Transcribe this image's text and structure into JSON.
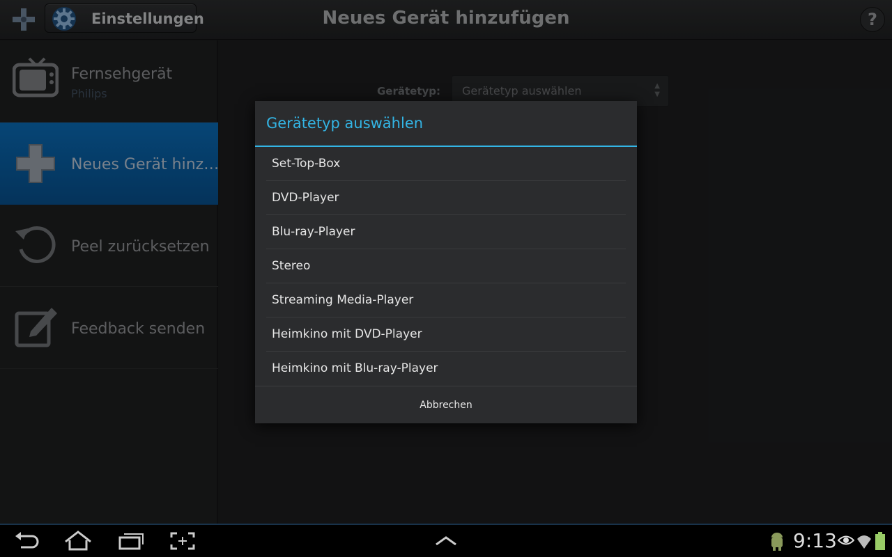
{
  "action_bar": {
    "settings_label": "Einstellungen",
    "title": "Neues Gerät hinzufügen",
    "help_label": "?"
  },
  "sidebar": {
    "items": [
      {
        "title": "Fernsehgerät",
        "subtitle": "Philips",
        "icon": "tv-icon",
        "active": false
      },
      {
        "title": "Neues Gerät hinz…",
        "subtitle": "",
        "icon": "plus-icon",
        "active": true
      },
      {
        "title": "Peel zurücksetzen",
        "subtitle": "",
        "icon": "reset-icon",
        "active": false
      },
      {
        "title": "Feedback senden",
        "subtitle": "",
        "icon": "edit-icon",
        "active": false
      }
    ]
  },
  "main": {
    "type_label": "Gerätetyp:",
    "type_select_value": "Gerätetyp auswählen"
  },
  "dialog": {
    "title": "Gerätetyp auswählen",
    "options": [
      "Set-Top-Box",
      "DVD-Player",
      "Blu-ray-Player",
      "Stereo",
      "Streaming Media-Player",
      "Heimkino mit DVD-Player",
      "Heimkino mit Blu-ray-Player"
    ],
    "cancel_label": "Abbrechen"
  },
  "system_bar": {
    "clock": "9:13"
  },
  "colors": {
    "accent": "#33b5e5",
    "active_item": "#0a6bb5"
  }
}
